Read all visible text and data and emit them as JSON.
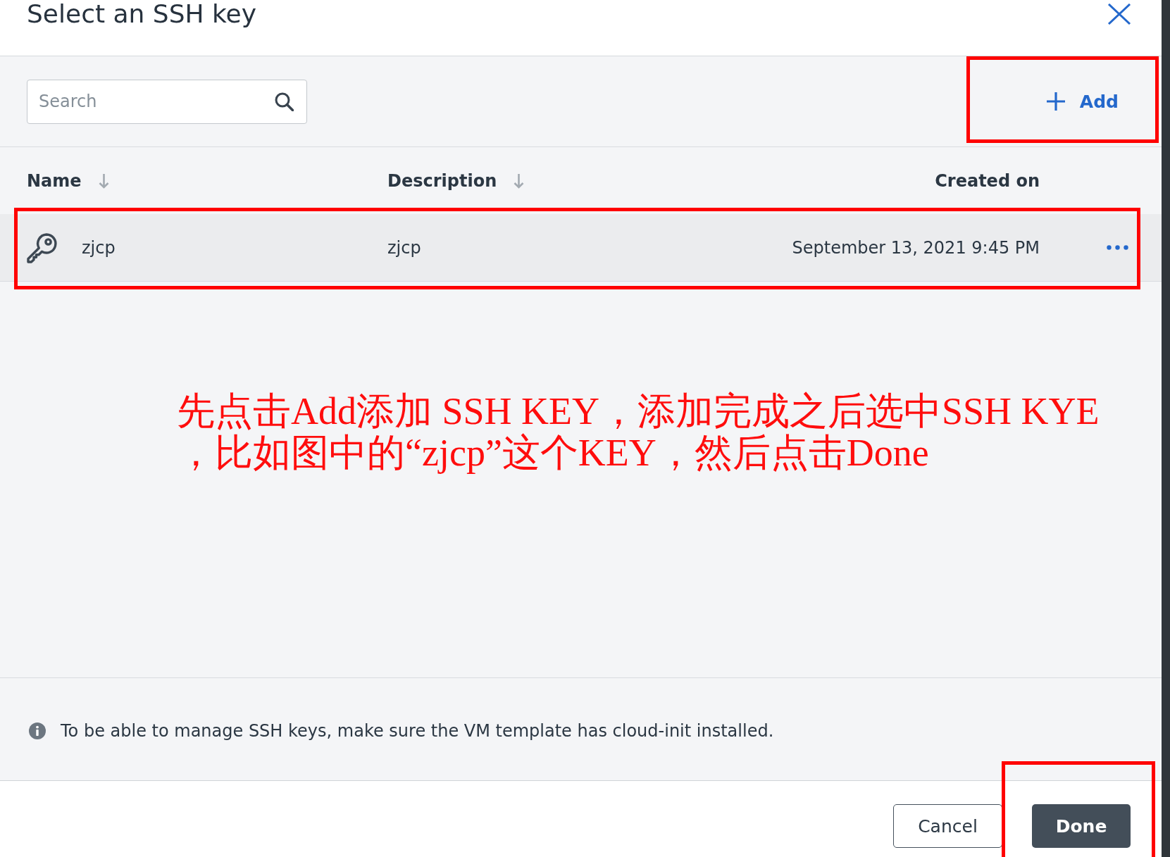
{
  "dialog": {
    "title": "Select an SSH key"
  },
  "toolbar": {
    "search": {
      "placeholder": "Search"
    },
    "add_button": {
      "label": "Add",
      "highlighted": true
    }
  },
  "table": {
    "columns": [
      {
        "label": "Name",
        "sortable": true
      },
      {
        "label": "Description",
        "sortable": true
      },
      {
        "label": "Created on",
        "sortable": false
      }
    ],
    "rows": [
      {
        "name": "zjcp",
        "description": "zjcp",
        "created_on": "September 13, 2021 9:45 PM",
        "selected": true,
        "highlighted": true
      }
    ]
  },
  "annotation": {
    "lines": [
      "先点击Add添加 SSH KEY，添加完成之后选中SSH KYE",
      "，比如图中的“zjcp”这个KEY，然后点击Done"
    ]
  },
  "info": {
    "text": "To be able to manage SSH keys, make sure the VM template has cloud-init installed."
  },
  "buttons": [
    {
      "label": "Cancel",
      "kind": "secondary",
      "highlighted": false
    },
    {
      "label": "Done",
      "kind": "primary",
      "highlighted": true
    }
  ]
}
